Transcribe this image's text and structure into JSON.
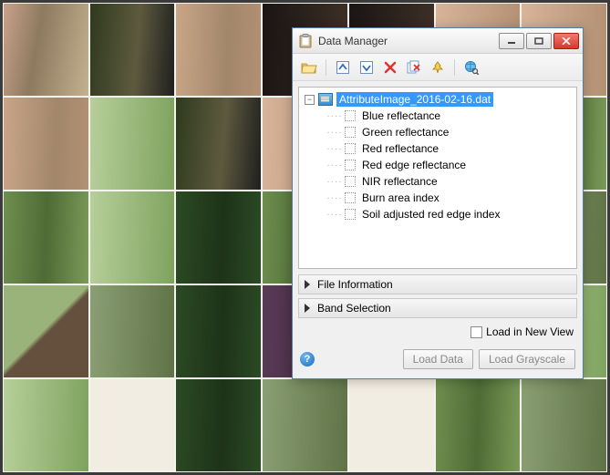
{
  "window": {
    "title": "Data Manager"
  },
  "tree": {
    "root_label": "AttributeImage_2016-02-16.dat",
    "children": [
      {
        "label": "Blue reflectance"
      },
      {
        "label": "Green reflectance"
      },
      {
        "label": "Red reflectance"
      },
      {
        "label": "Red edge reflectance"
      },
      {
        "label": "NIR reflectance"
      },
      {
        "label": "Burn area index"
      },
      {
        "label": "Soil adjusted red edge index"
      }
    ]
  },
  "sections": {
    "file_info": "File Information",
    "band_sel": "Band Selection"
  },
  "options": {
    "load_new_view": "Load in New View"
  },
  "buttons": {
    "load_data": "Load Data",
    "load_grayscale": "Load Grayscale"
  }
}
